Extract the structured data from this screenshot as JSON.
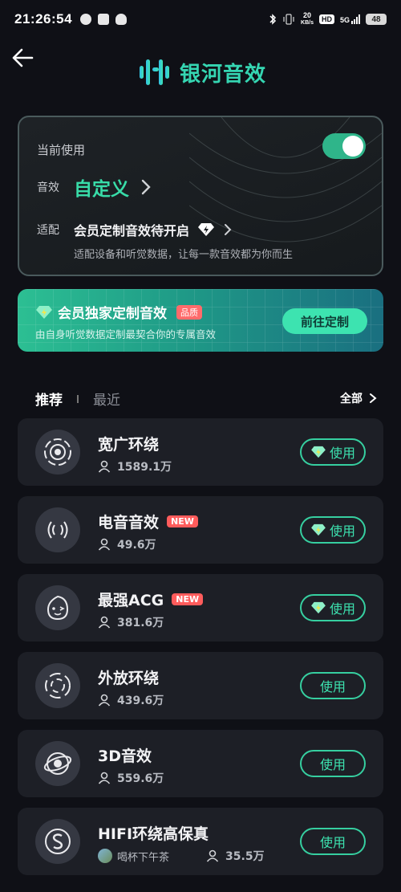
{
  "status_bar": {
    "time": "21:26:54",
    "net_speed_top": "20",
    "net_speed_unit": "KB/s",
    "hd": "HD",
    "network": "5G",
    "battery": "48"
  },
  "header": {
    "back_icon": "back-arrow-icon",
    "logo_text": "银河音效"
  },
  "current": {
    "label": "当前使用",
    "toggle_on": true,
    "effect_key": "音效",
    "effect_value": "自定义",
    "adapt_key": "适配",
    "adapt_value": "会员定制音效待开启",
    "adapt_desc": "适配设备和听觉数据，让每一款音效都为你而生"
  },
  "banner": {
    "title": "会员独家定制音效",
    "badge": "品质",
    "subtitle": "由自身听觉数据定制最契合你的专属音效",
    "button": "前往定制"
  },
  "tabs": {
    "recommended": "推荐",
    "recent": "最近",
    "all": "全部"
  },
  "items": [
    {
      "name": "宽广环绕",
      "users": "1589.1万",
      "button": "使用",
      "vip": true,
      "badge": "",
      "icon": "surround-icon"
    },
    {
      "name": "电音音效",
      "users": "49.6万",
      "button": "使用",
      "vip": true,
      "badge": "NEW",
      "icon": "sound-wave-icon"
    },
    {
      "name": "最强ACG",
      "users": "381.6万",
      "button": "使用",
      "vip": true,
      "badge": "NEW",
      "icon": "anime-face-icon"
    },
    {
      "name": "外放环绕",
      "users": "439.6万",
      "button": "使用",
      "vip": false,
      "badge": "",
      "icon": "speaker-surround-icon"
    },
    {
      "name": "3D音效",
      "users": "559.6万",
      "button": "使用",
      "vip": false,
      "badge": "",
      "icon": "orbit-3d-icon"
    },
    {
      "name": "HIFI环绕高保真",
      "author": "喝杯下午茶",
      "users": "35.5万",
      "button": "使用",
      "vip": false,
      "badge": "",
      "icon": "hifi-s-icon"
    }
  ],
  "colors": {
    "accent": "#38dca8",
    "background": "#0f1016",
    "card": "#1d1f26",
    "new_badge": "#ff5c5c"
  }
}
